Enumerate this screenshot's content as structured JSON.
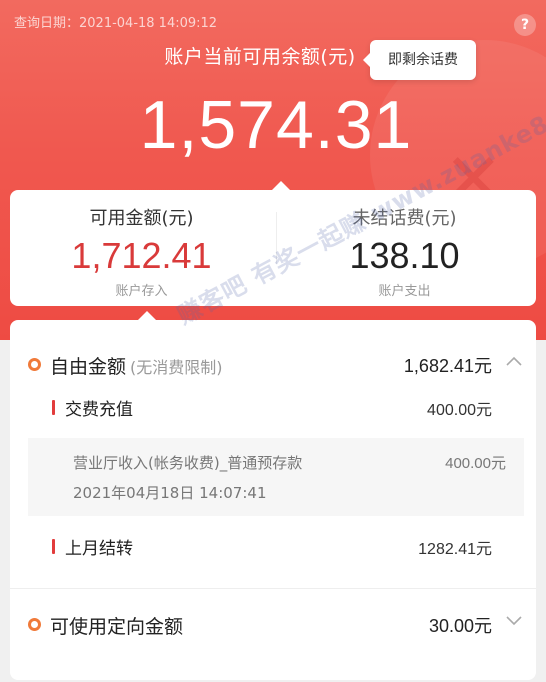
{
  "header": {
    "query_date": "查询日期：2021-04-18 14:09:12",
    "help_icon": "question-icon",
    "balance_caption": "账户当前可用余额(元)",
    "tooltip": "即剩余话费",
    "balance_amount": "1,574.31",
    "colors": {
      "hero_top": "#f26a5f",
      "hero_bottom": "#ee4b43"
    }
  },
  "summary": {
    "available": {
      "label": "可用金额(元)",
      "value": "1,712.41",
      "sub": "账户存入"
    },
    "unsettled": {
      "label": "未结话费(元)",
      "value": "138.10",
      "sub": "账户支出"
    },
    "colors": {
      "available_value": "#d93a3a"
    }
  },
  "details": {
    "free_amount": {
      "title": "自由金额",
      "note": "(无消费限制)",
      "amount": "1,682.41元",
      "chevron": "chevron-up-icon"
    },
    "recharge": {
      "label": "交费充值",
      "amount": "400.00元"
    },
    "transaction": {
      "description": "营业厅收入(帐务收费)_普通预存款",
      "amount": "400.00元",
      "time": "2021年04月18日 14:07:41"
    },
    "carry_over": {
      "label": "上月结转",
      "amount": "1282.41元"
    },
    "directed_amount": {
      "title": "可使用定向金额",
      "amount": "30.00元",
      "chevron": "chevron-down-icon"
    },
    "colors": {
      "section_dot": "#f07a3a",
      "item_bar": "#e23c3c"
    }
  },
  "watermark": "赚客吧 有奖一起赚 www.zuanke8.com"
}
